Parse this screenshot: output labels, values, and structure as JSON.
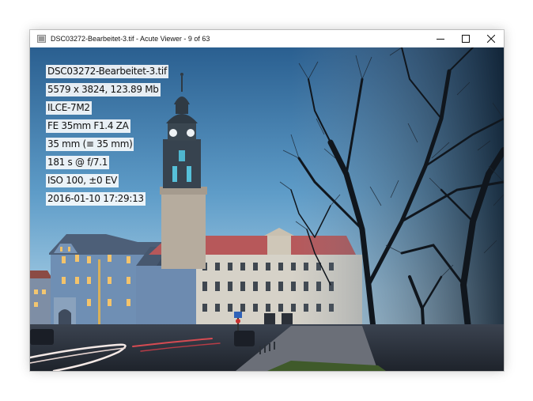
{
  "window": {
    "title": "DSC03272-Bearbeitet-3.tif - Acute Viewer - 9 of 63",
    "app_icon": "image-viewer-icon"
  },
  "caption_buttons": {
    "minimize_icon": "minimize-icon",
    "maximize_icon": "maximize-icon",
    "close_icon": "close-icon"
  },
  "image": {
    "description_hint": "photo",
    "overlay": {
      "filename": "DSC03272-Bearbeitet-3.tif",
      "dimensions": "5579 x 3824, 123.89 Mb",
      "camera": "ILCE-7M2",
      "lens": "FE 35mm F1.4 ZA",
      "focal_length": "35 mm (≡ 35 mm)",
      "exposure": "181 s @ f/7.1",
      "iso_ev": "ISO 100, ±0 EV",
      "datetime": "2016-01-10 17:29:13"
    }
  }
}
